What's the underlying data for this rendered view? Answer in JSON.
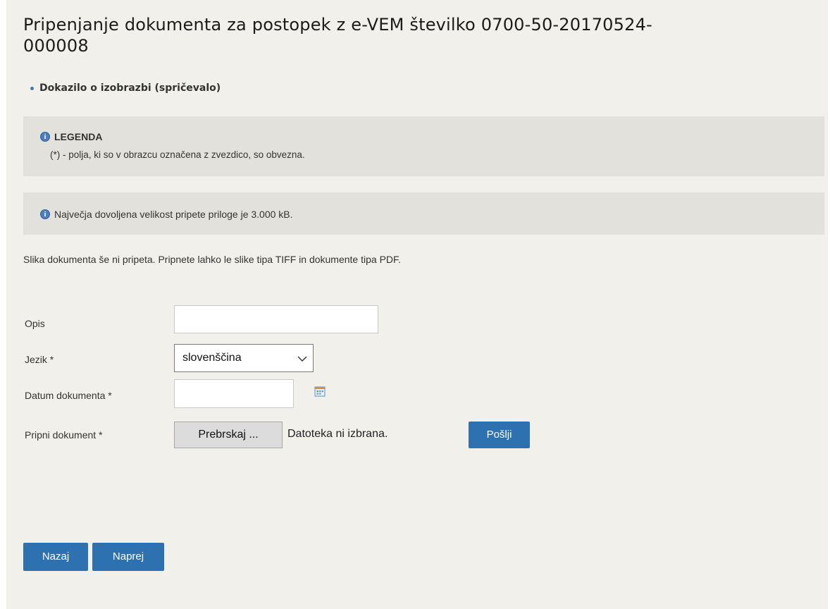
{
  "page": {
    "title": "Pripenjanje dokumenta za postopek z e-VEM številko 0700-50-20170524-000008"
  },
  "document_type": "Dokazilo o izobrazbi (spričevalo)",
  "legend": {
    "icon": "info-icon",
    "icon_glyph": "i",
    "title": "LEGENDA",
    "text": "(*) - polja, ki so v obrazcu označena z zvezdico, so obvezna."
  },
  "size_info": {
    "icon": "info-icon",
    "icon_glyph": "i",
    "text": "Največja dovoljena velikost pripete priloge je 3.000 kB."
  },
  "note": "Slika dokumenta še ni pripeta. Pripnete lahko le slike tipa TIFF in dokumente tipa PDF.",
  "form": {
    "description": {
      "label": "Opis",
      "value": ""
    },
    "language": {
      "label": "Jezik *",
      "value": "slovenščina"
    },
    "date": {
      "label": "Datum dokumenta *",
      "value": "",
      "icon": "calendar-icon"
    },
    "attach": {
      "label": "Pripni dokument *",
      "browse_label": "Prebrskaj ...",
      "file_status": "Datoteka ni izbrana.",
      "send_label": "Pošlji"
    }
  },
  "navigation": {
    "back_label": "Nazaj",
    "next_label": "Naprej"
  },
  "colors": {
    "page_background": "#f1f0eb",
    "info_box_background": "#e2e1dc",
    "button_primary": "#2e71b0",
    "info_icon": "#4a7ec0"
  }
}
